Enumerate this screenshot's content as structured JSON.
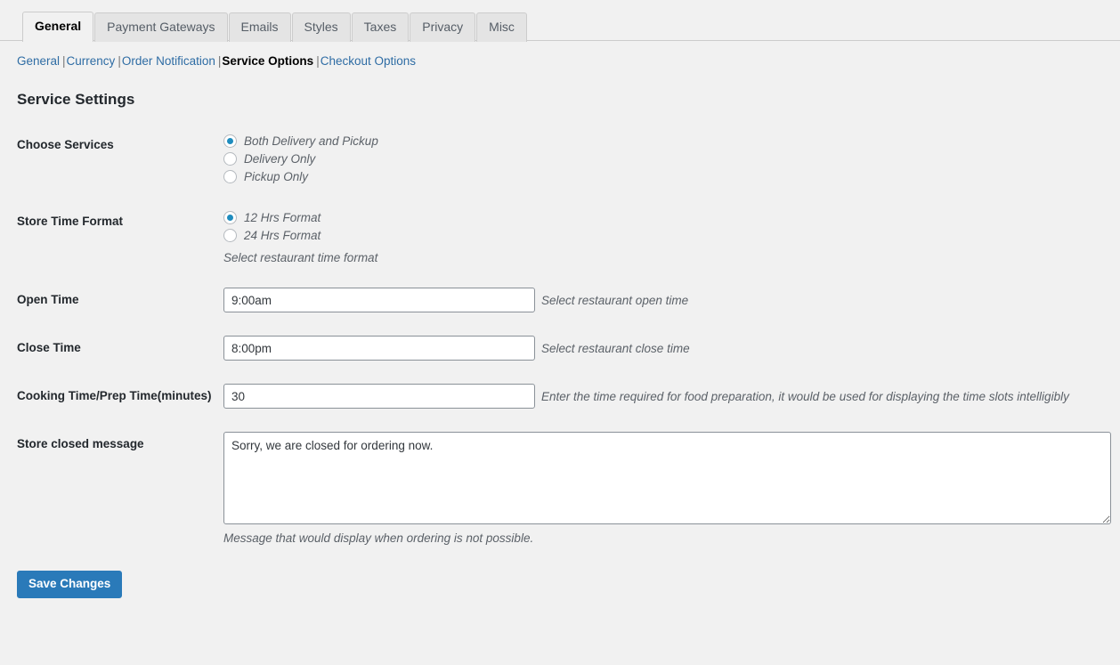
{
  "tabs": [
    {
      "label": "General",
      "active": true
    },
    {
      "label": "Payment Gateways",
      "active": false
    },
    {
      "label": "Emails",
      "active": false
    },
    {
      "label": "Styles",
      "active": false
    },
    {
      "label": "Taxes",
      "active": false
    },
    {
      "label": "Privacy",
      "active": false
    },
    {
      "label": "Misc",
      "active": false
    }
  ],
  "subnav": {
    "items": [
      {
        "label": "General",
        "current": false
      },
      {
        "label": "Currency",
        "current": false
      },
      {
        "label": "Order Notification",
        "current": false
      },
      {
        "label": "Service Options",
        "current": true
      },
      {
        "label": "Checkout Options",
        "current": false
      }
    ],
    "separator": "|"
  },
  "heading": "Service Settings",
  "fields": {
    "choose_services": {
      "label": "Choose Services",
      "options": [
        {
          "label": "Both Delivery and Pickup",
          "checked": true
        },
        {
          "label": "Delivery Only",
          "checked": false
        },
        {
          "label": "Pickup Only",
          "checked": false
        }
      ]
    },
    "store_time_format": {
      "label": "Store Time Format",
      "options": [
        {
          "label": "12 Hrs Format",
          "checked": true
        },
        {
          "label": "24 Hrs Format",
          "checked": false
        }
      ],
      "description": "Select restaurant time format"
    },
    "open_time": {
      "label": "Open Time",
      "value": "9:00am",
      "description": "Select restaurant open time"
    },
    "close_time": {
      "label": "Close Time",
      "value": "8:00pm",
      "description": "Select restaurant close time"
    },
    "cooking_time": {
      "label": "Cooking Time/Prep Time(minutes)",
      "value": "30",
      "description": "Enter the time required for food preparation, it would be used for displaying the time slots intelligibly"
    },
    "store_closed_message": {
      "label": "Store closed message",
      "value": "Sorry, we are closed for ordering now.",
      "description": "Message that would display when ordering is not possible."
    }
  },
  "submit": {
    "label": "Save Changes"
  },
  "colors": {
    "accent": "#2a7ab9",
    "radio_dot": "#1e8cbe",
    "link": "#2e6ca4",
    "background": "#f1f1f1"
  }
}
